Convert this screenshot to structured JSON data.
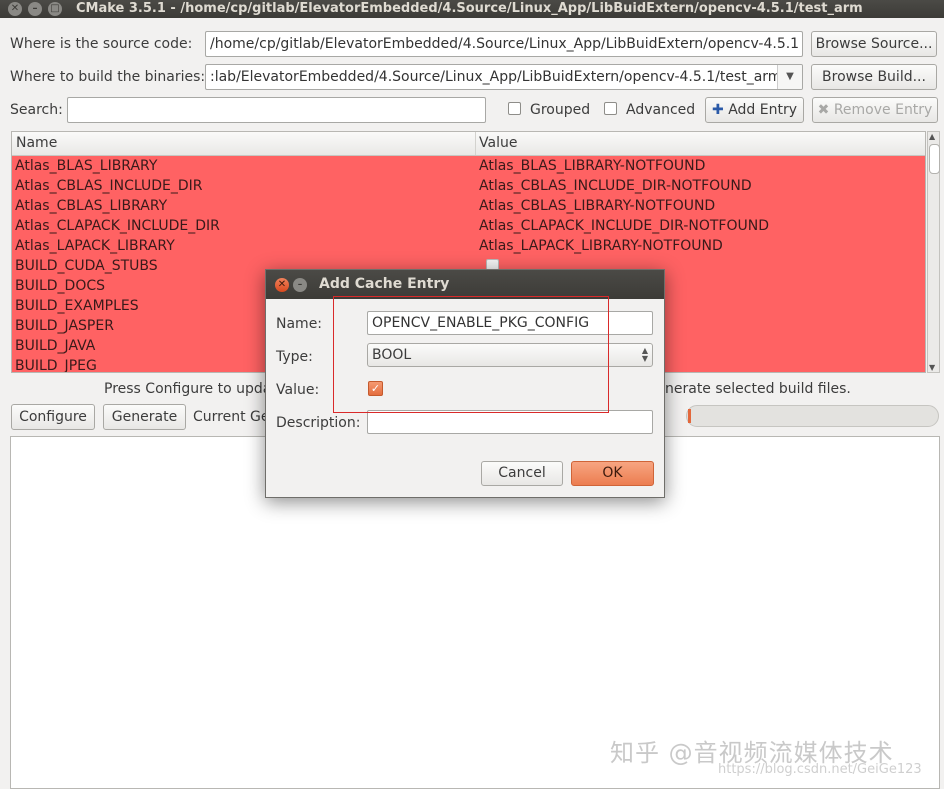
{
  "window": {
    "title": "CMake 3.5.1 - /home/cp/gitlab/ElevatorEmbedded/4.Source/Linux_App/LibBuidExtern/opencv-4.5.1/test_arm"
  },
  "source": {
    "label": "Where is the source code:",
    "value": "/home/cp/gitlab/ElevatorEmbedded/4.Source/Linux_App/LibBuidExtern/opencv-4.5.1",
    "browse_label": "Browse Source..."
  },
  "build": {
    "label": "Where to build the binaries:",
    "value": ":lab/ElevatorEmbedded/4.Source/Linux_App/LibBuidExtern/opencv-4.5.1/test_arm",
    "browse_label": "Browse Build..."
  },
  "search": {
    "label": "Search:",
    "value": "",
    "grouped_label": "Grouped",
    "advanced_label": "Advanced",
    "add_entry_label": "Add Entry",
    "remove_entry_label": "Remove Entry"
  },
  "table": {
    "col_name": "Name",
    "col_value": "Value",
    "rows": [
      {
        "name": "Atlas_BLAS_LIBRARY",
        "value": "Atlas_BLAS_LIBRARY-NOTFOUND"
      },
      {
        "name": "Atlas_CBLAS_INCLUDE_DIR",
        "value": "Atlas_CBLAS_INCLUDE_DIR-NOTFOUND"
      },
      {
        "name": "Atlas_CBLAS_LIBRARY",
        "value": "Atlas_CBLAS_LIBRARY-NOTFOUND"
      },
      {
        "name": "Atlas_CLAPACK_INCLUDE_DIR",
        "value": "Atlas_CLAPACK_INCLUDE_DIR-NOTFOUND"
      },
      {
        "name": "Atlas_LAPACK_LIBRARY",
        "value": "Atlas_LAPACK_LIBRARY-NOTFOUND"
      },
      {
        "name": "BUILD_CUDA_STUBS",
        "value": ""
      },
      {
        "name": "BUILD_DOCS",
        "value": ""
      },
      {
        "name": "BUILD_EXAMPLES",
        "value": ""
      },
      {
        "name": "BUILD_JASPER",
        "value": ""
      },
      {
        "name": "BUILD_JAVA",
        "value": ""
      },
      {
        "name": "BUILD_JPEG",
        "value": ""
      }
    ]
  },
  "status": {
    "left_text": "Press Configure to upda",
    "right_text": "nerate selected build files.",
    "configure_label": "Configure",
    "generate_label": "Generate",
    "current_gen_label": "Current Ge",
    "progress_percent": 1
  },
  "dialog": {
    "title": "Add Cache Entry",
    "name_label": "Name:",
    "name_value": "OPENCV_ENABLE_PKG_CONFIG",
    "type_label": "Type:",
    "type_value": "BOOL",
    "value_label": "Value:",
    "value_checked": true,
    "description_label": "Description:",
    "description_value": "",
    "cancel_label": "Cancel",
    "ok_label": "OK"
  },
  "watermark": {
    "main": "知乎 @音视频流媒体技术",
    "url": "https://blog.csdn.net/GeiGe123"
  },
  "colors": {
    "row_error": "#ff6263",
    "accent": "#ec7d50",
    "annotation": "#d92a2a"
  }
}
